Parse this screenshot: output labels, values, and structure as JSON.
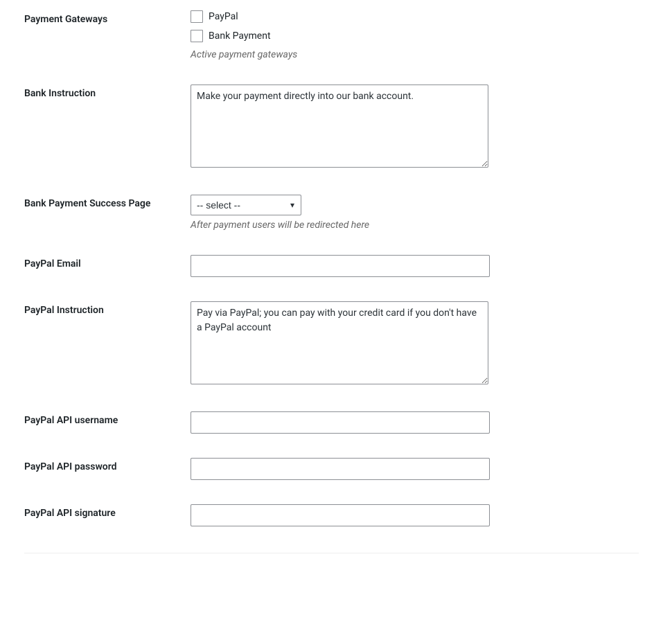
{
  "labels": {
    "payment_gateways": "Payment Gateways",
    "bank_instruction": "Bank Instruction",
    "bank_payment_success_page": "Bank Payment Success Page",
    "paypal_email": "PayPal Email",
    "paypal_instruction": "PayPal Instruction",
    "paypal_api_username": "PayPal API username",
    "paypal_api_password": "PayPal API password",
    "paypal_api_signature": "PayPal API signature"
  },
  "gateways": {
    "paypal": "PayPal",
    "bank": "Bank Payment",
    "description": "Active payment gateways"
  },
  "bank_instruction": {
    "value": "Make your payment directly into our bank account."
  },
  "bank_success_page": {
    "selected": "-- select --",
    "description": "After payment users will be redirected here"
  },
  "paypal_email": {
    "value": ""
  },
  "paypal_instruction": {
    "value": "Pay via PayPal; you can pay with your credit card if you don't have a PayPal account"
  },
  "paypal_api_username": {
    "value": ""
  },
  "paypal_api_password": {
    "value": ""
  },
  "paypal_api_signature": {
    "value": ""
  }
}
